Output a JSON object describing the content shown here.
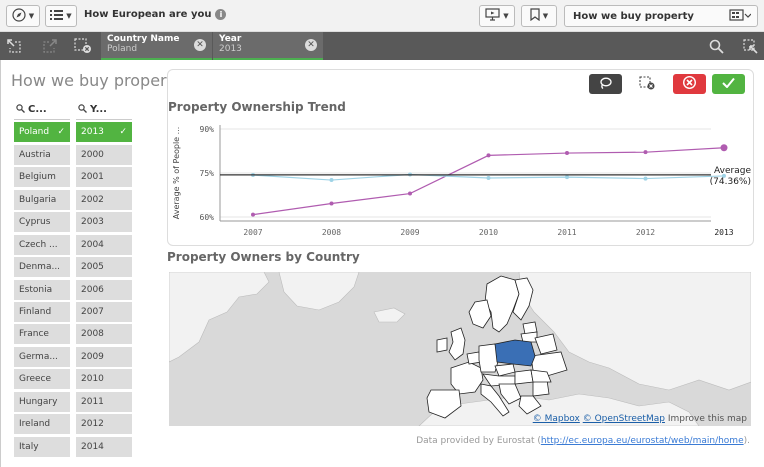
{
  "toolbar": {
    "app_title": "How European are you",
    "sheet_name": "How we buy property"
  },
  "selections": [
    {
      "field": "Country Name",
      "value": "Poland"
    },
    {
      "field": "Year",
      "value": "2013"
    }
  ],
  "sheet": {
    "title": "How we buy property"
  },
  "country_list": {
    "header": "C...",
    "items": [
      "Poland",
      "Austria",
      "Belgium",
      "Bulgaria",
      "Cyprus",
      "Czech ...",
      "Denma...",
      "Estonia",
      "Finland",
      "France",
      "Germa...",
      "Greece",
      "Hungary",
      "Ireland",
      "Italy"
    ]
  },
  "year_list": {
    "header": "Y...",
    "items": [
      "2013",
      "2000",
      "2001",
      "2002",
      "2003",
      "2004",
      "2005",
      "2006",
      "2007",
      "2008",
      "2009",
      "2010",
      "2011",
      "2012",
      "2014"
    ]
  },
  "chart_data": {
    "type": "line",
    "title": "Property Ownership Trend",
    "ylabel": "Average % of People ...",
    "xlabel": "",
    "categories": [
      "2007",
      "2008",
      "2009",
      "2010",
      "2011",
      "2012",
      "2013"
    ],
    "y_ticks": [
      "90%",
      "75%",
      "60%"
    ],
    "ylim": [
      60,
      90
    ],
    "series": [
      {
        "values": [
          60.8,
          64.6,
          68.0,
          81.0,
          81.8,
          82.1,
          83.6
        ],
        "color": "#b05cb0"
      },
      {
        "values": [
          74.3,
          72.6,
          74.5,
          73.3,
          73.6,
          73.1,
          74.0
        ],
        "color": "#9fd3e6"
      }
    ],
    "reference_line": {
      "value": 74.36,
      "label": "Average",
      "value_label": "(74.36%)"
    },
    "highlight_category": "2013",
    "grid": true
  },
  "map": {
    "title": "Property Owners by Country",
    "highlighted_country": "Poland",
    "highlight_color": "#3a6fb5",
    "credit_mapbox": "© Mapbox",
    "credit_osm": "© OpenStreetMap",
    "credit_improve": "Improve this map"
  },
  "footer": {
    "prefix": "Data provided by Eurostat (",
    "link": "http://ec.europa.eu/eurostat/web/main/home",
    "suffix": ")."
  },
  "colors": {
    "selected": "#52b441",
    "cancel": "#e0393e",
    "confirm": "#52b441"
  }
}
